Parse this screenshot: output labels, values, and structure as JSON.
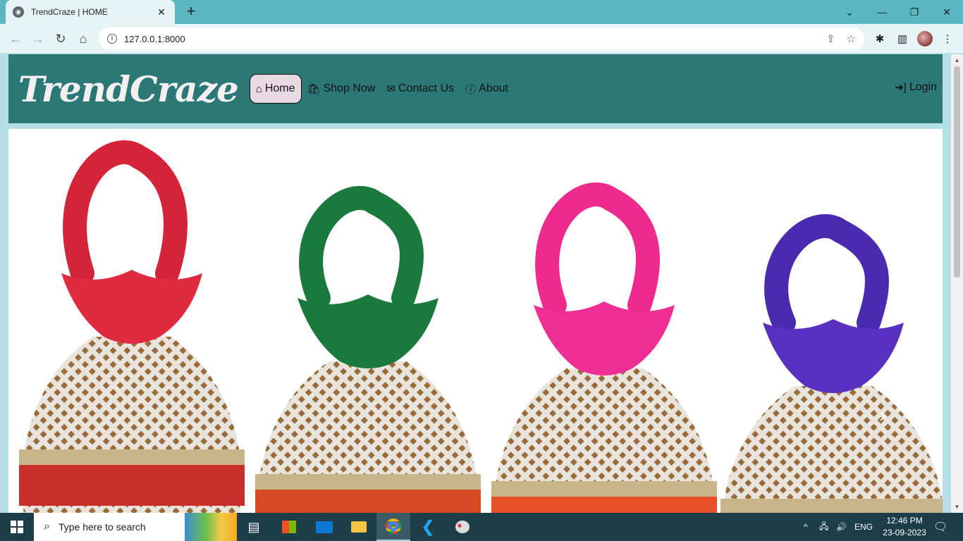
{
  "browser": {
    "tab_title": "TrendCraze | HOME",
    "tab_close": "✕",
    "new_tab": "+",
    "url": "127.0.0.1:8000",
    "info_glyph": "i"
  },
  "site": {
    "brand": "TrendCraze",
    "nav": [
      {
        "label": "Home",
        "icon": "home-icon",
        "active": true
      },
      {
        "label": "Shop Now",
        "icon": "shopping-bag-icon"
      },
      {
        "label": "Contact Us",
        "icon": "envelope-icon"
      },
      {
        "label": "About",
        "icon": "info-circle-icon"
      }
    ],
    "login_label": "Login"
  },
  "carousel": {
    "next_glyph": "›",
    "bags": [
      {
        "handle_color": "#d4243a",
        "ruffle_color": "#e02a3f",
        "band_color": "#c9302c"
      },
      {
        "handle_color": "#1a7a3e",
        "ruffle_color": "#1a7a3e",
        "band_color": "#d84a25"
      },
      {
        "handle_color": "#ee2a8f",
        "ruffle_color": "#f02d92",
        "band_color": "#e8502a"
      },
      {
        "handle_color": "#4a2bb0",
        "ruffle_color": "#5a30c0",
        "band_color": "#7a4bc8"
      }
    ]
  },
  "taskbar": {
    "search_placeholder": "Type here to search",
    "tray_language": "ENG",
    "time": "12:46 PM",
    "date": "23-09-2023"
  },
  "colors": {
    "navbar_bg": "#2c7877",
    "page_bg": "#b5dfe4",
    "active_nav_bg": "#e9d9e3",
    "browser_frame": "#5ab7c2"
  }
}
